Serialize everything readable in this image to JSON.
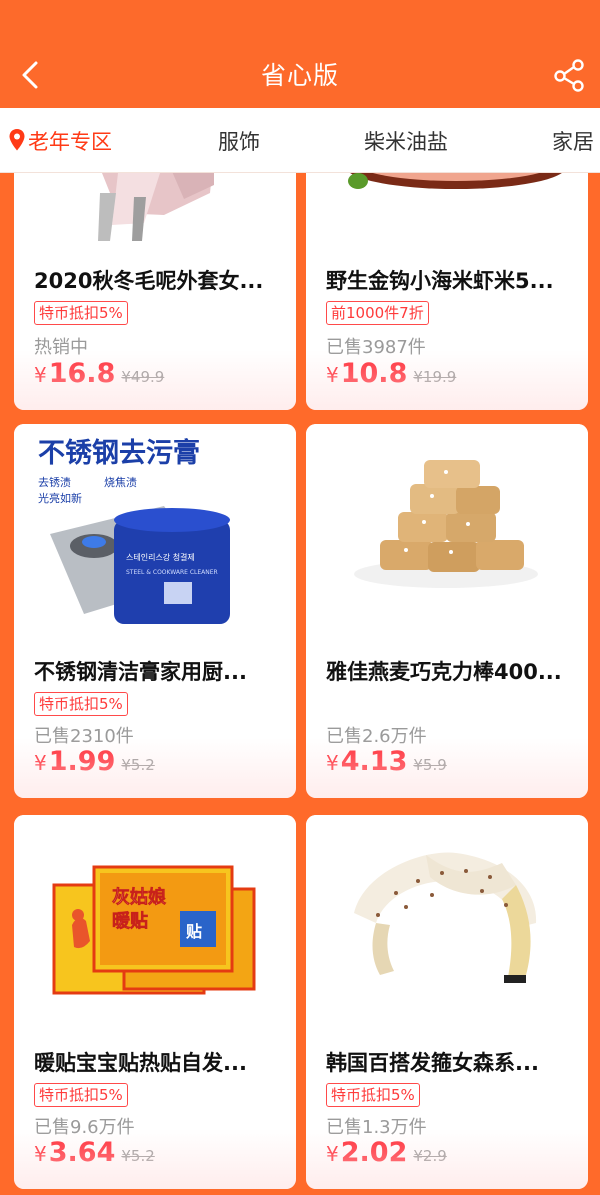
{
  "header": {
    "title": "省心版"
  },
  "tabs": [
    "老年专区",
    "服饰",
    "柴米油盐",
    "家居"
  ],
  "products": [
    {
      "name": "2020秋冬毛呢外套女...",
      "tag": "特币抵扣5%",
      "sales": "热销中",
      "yen": "¥",
      "price": "16.8",
      "orig_price": "¥49.9",
      "image": "coat-photo"
    },
    {
      "name": "野生金钩小海米虾米5...",
      "tag": "前1000件7折",
      "sales": "已售3987件",
      "yen": "¥",
      "price": "10.8",
      "orig_price": "¥19.9",
      "image": "shrimp-photo"
    },
    {
      "name": "不锈钢清洁膏家用厨...",
      "tag": "特币抵扣5%",
      "sales": "已售2310件",
      "yen": "¥",
      "price": "1.99",
      "orig_price": "¥5.2",
      "image": "cleaner-photo",
      "image_text": {
        "headline": "不锈钢去污膏",
        "points": [
          "去锈渍",
          "烧焦渍",
          "光亮如新"
        ],
        "label": "스테인리스강 청결제",
        "sub": "STEEL & COOKWARE CLEANER"
      }
    },
    {
      "name": "雅佳燕麦巧克力棒400...",
      "tag": "",
      "sales": "已售2.6万件",
      "yen": "¥",
      "price": "4.13",
      "orig_price": "¥5.9",
      "image": "oat-bar-photo"
    },
    {
      "name": "暖贴宝宝贴热贴自发...",
      "tag": "特币抵扣5%",
      "sales": "已售9.6万件",
      "yen": "¥",
      "price": "3.64",
      "orig_price": "¥5.2",
      "image": "heat-patch-photo",
      "image_text": {
        "brand": "灰姑娘",
        "product": "暖贴",
        "word": "贴"
      }
    },
    {
      "name": "韩国百搭发箍女森系...",
      "tag": "特币抵扣5%",
      "sales": "已售1.3万件",
      "yen": "¥",
      "price": "2.02",
      "orig_price": "¥2.9",
      "image": "headband-photo"
    }
  ],
  "colors": {
    "brand": "#fd6a2b",
    "price": "#ff2d38",
    "tag": "#ff3b3b"
  },
  "icons": {
    "back": "chevron-left-icon",
    "share": "share-icon",
    "location": "location-pin-icon"
  }
}
